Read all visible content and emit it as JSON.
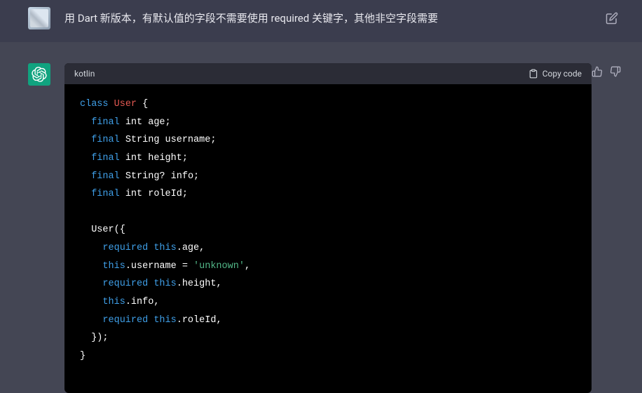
{
  "user": {
    "message": "用 Dart 新版本，有默认值的字段不需要使用 required  关键字，其他非空字段需要"
  },
  "assistant": {
    "code": {
      "language": "kotlin",
      "copy_label": "Copy code",
      "tokens": {
        "class": "class",
        "final": "final",
        "required": "required",
        "this": "this",
        "clsUser": "User",
        "strUnknown": "'unknown'",
        "tInt": " int ",
        "tString": " String ",
        "tStringQ": " String? ",
        "fAge": "age",
        "fUsername": "username",
        "fHeight": "height",
        "fInfo": "info",
        "fRoleId": "roleId",
        "semi": ";",
        "lbrace": " {",
        "lbraceOpen": "({",
        "dotAge": ".age,",
        "dotUsername": ".username = ",
        "comma": ",",
        "dotHeight": ".height,",
        "dotInfo": ".info,",
        "dotRoleId": ".roleId,",
        "closeCtor": "});",
        "rbrace": "}"
      }
    }
  }
}
